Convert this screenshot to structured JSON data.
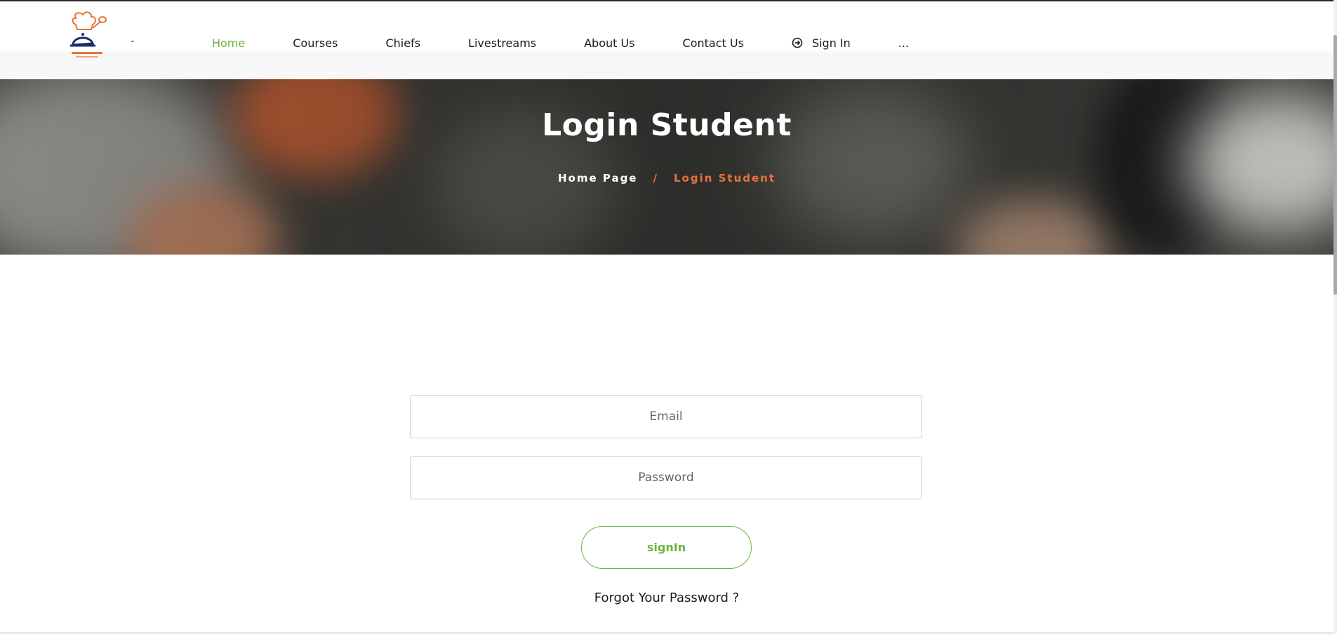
{
  "nav": {
    "home": "Home",
    "courses": "Courses",
    "chiefs": "Chiefs",
    "livestreams": "Livestreams",
    "about": "About Us",
    "contact": "Contact Us",
    "signin": "Sign In",
    "more": "..."
  },
  "hero": {
    "title": "Login Student",
    "breadcrumb_home": "Home Page",
    "breadcrumb_separator": "/",
    "breadcrumb_current": "Login Student"
  },
  "form": {
    "email_placeholder": "Email",
    "password_placeholder": "Password",
    "signin_label": "signIn",
    "forgot_label": "Forgot Your Password ?"
  },
  "colors": {
    "accent_green": "#6cb33f",
    "accent_orange": "#e8743b",
    "text_dark": "#1b1b1b"
  },
  "icons": {
    "logo": "chef-hat-logo",
    "signin": "circle-arrow-right-icon"
  }
}
